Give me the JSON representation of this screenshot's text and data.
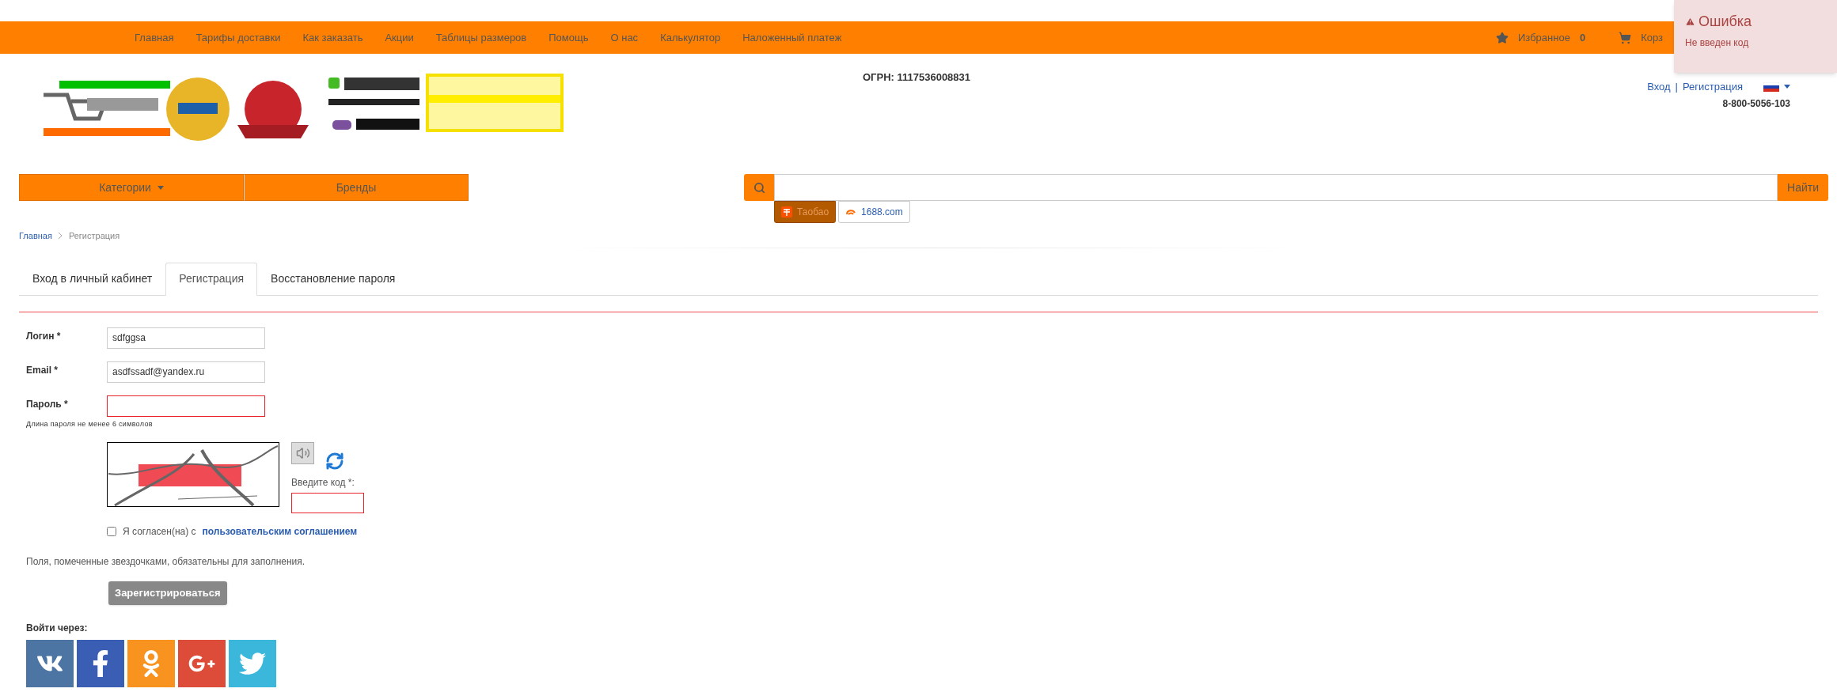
{
  "top_nav": {
    "items": [
      "Главная",
      "Тарифы доставки",
      "Как заказать",
      "Акции",
      "Таблицы размеров",
      "Помощь",
      "О нас",
      "Калькулятор",
      "Наложенный платеж"
    ],
    "favorites": {
      "label": "Избранное",
      "count": "0"
    },
    "cart": {
      "label": "Корз"
    }
  },
  "toast": {
    "title": "Ошибка",
    "message": "Не введен код"
  },
  "header": {
    "ogrn": "ОГРН: 1117536008831",
    "login_link": "Вход",
    "separator": "|",
    "register_link": "Регистрация",
    "phone": "8-800-5056-103"
  },
  "catalog_bar": [
    {
      "label": "Категории",
      "dropdown": true
    },
    {
      "label": "Бренды",
      "dropdown": false
    }
  ],
  "search": {
    "button": "Найти",
    "sources": [
      {
        "label": "Таобао",
        "selected": true
      },
      {
        "label": "1688.com",
        "selected": false
      }
    ]
  },
  "breadcrumb": [
    "Главная",
    "Регистрация"
  ],
  "tabs": [
    {
      "label": "Вход в личный кабинет",
      "selected": false
    },
    {
      "label": "Регистрация",
      "selected": true
    },
    {
      "label": "Восстановление пароля",
      "selected": false
    }
  ],
  "form": {
    "fields": [
      {
        "label": "Логин *",
        "value": "sdfggsa",
        "invalid": false
      },
      {
        "label": "Email *",
        "value": "asdfssadf@yandex.ru",
        "invalid": false
      },
      {
        "label": "Пароль *",
        "invalid": true,
        "hint": "Длина пароля не менее 6 символов"
      }
    ],
    "captcha": {
      "prompt": "Введите код *:",
      "invalid": true
    },
    "agreement": {
      "checked": false,
      "text": "Я согласен(на) с",
      "link": "пользовательским соглашением"
    },
    "note": "Поля, помеченные звездочками, обязательны для заполнения.",
    "submit": "Зарегистрироваться"
  },
  "social": {
    "title": "Войти через:",
    "buttons": [
      {
        "kind": "vk",
        "color": "#4c75a3"
      },
      {
        "kind": "facebook",
        "color": "#3b5eb5"
      },
      {
        "kind": "ok",
        "color": "#f7931e"
      },
      {
        "kind": "gplus",
        "color": "#dd4b39"
      },
      {
        "kind": "twitter",
        "color": "#3cb7dc"
      }
    ]
  }
}
